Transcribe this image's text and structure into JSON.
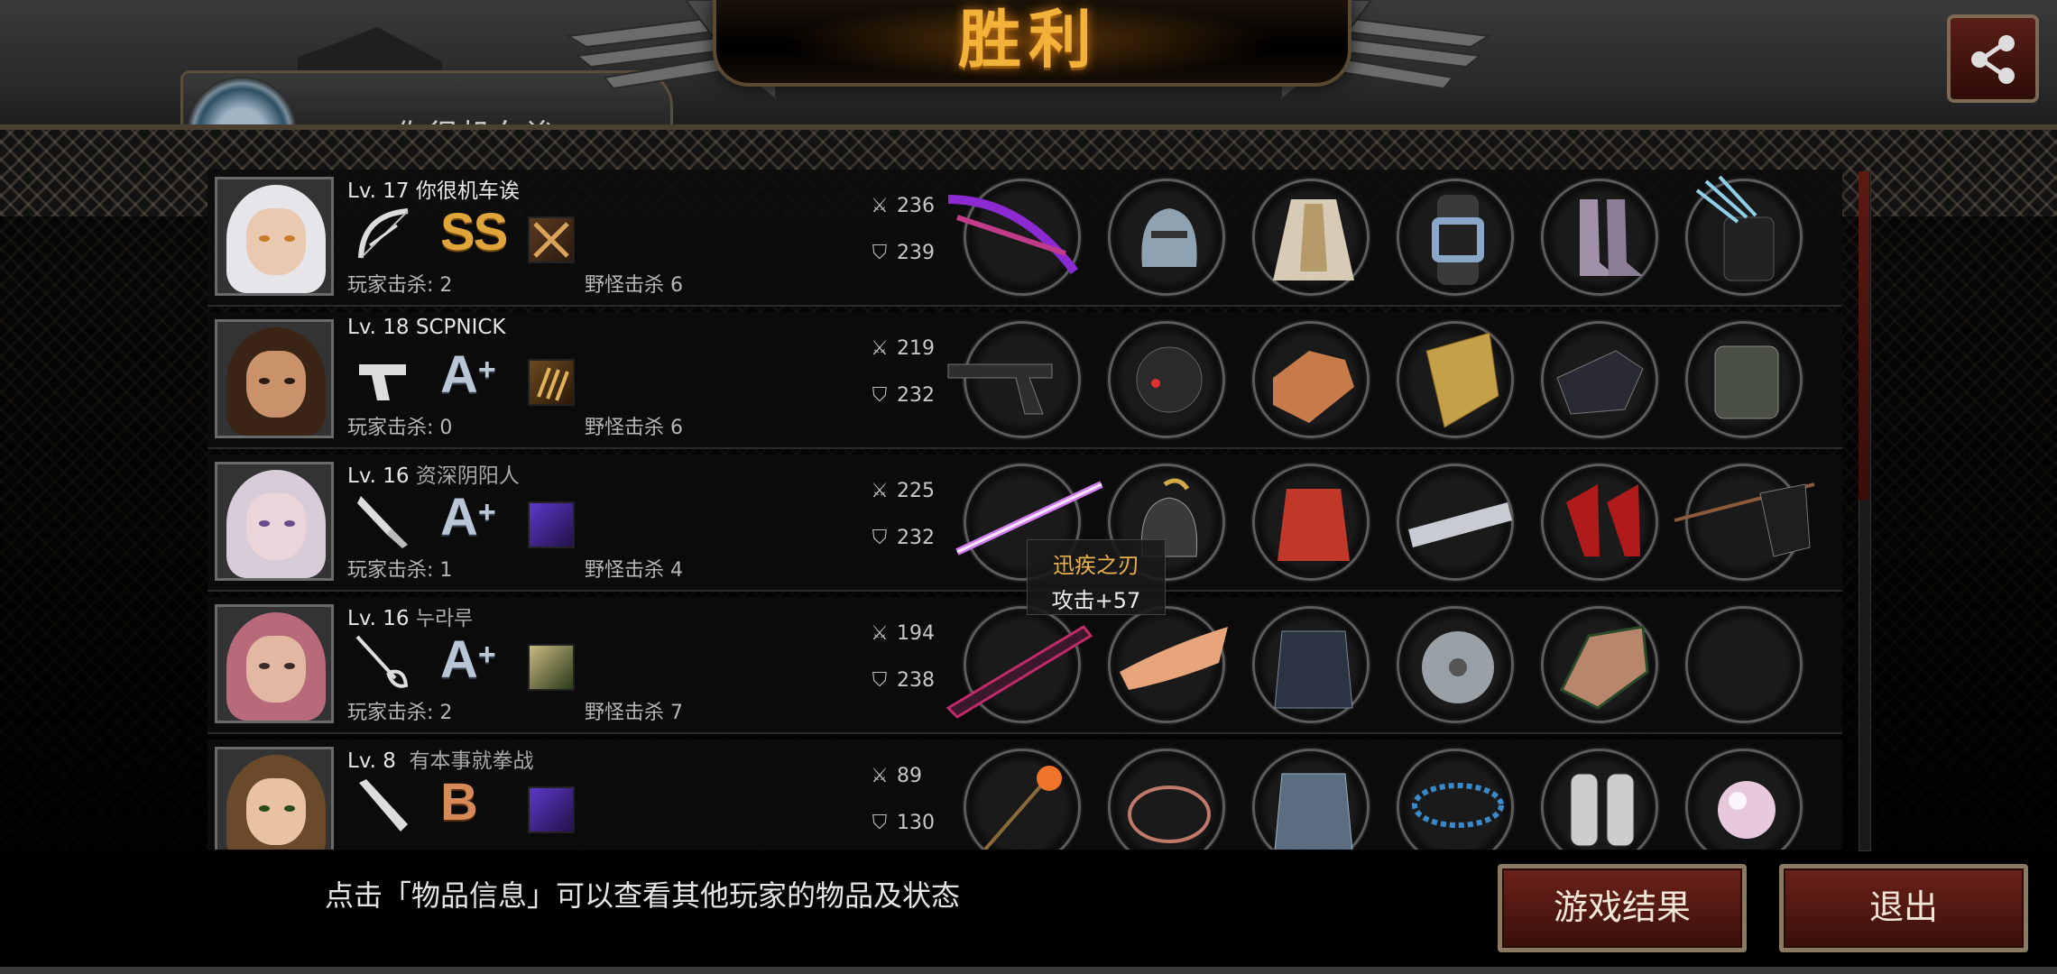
{
  "header": {
    "title": "胜利",
    "player_tab_text": "你很机车诶"
  },
  "tooltip": {
    "name": "迅疾之刃",
    "stat": "攻击+57"
  },
  "players": [
    {
      "level": "Lv. 17",
      "name": "你很机车诶",
      "weapon": "bow-icon",
      "grade": "SS",
      "skill": "crossed-blades-skill-icon",
      "player_kills_label": "玩家击杀: 2",
      "monster_kills_label": "野怪击杀 6",
      "attack": "236",
      "defense": "239",
      "items": [
        "purple-bow-icon",
        "helmet-icon",
        "cloak-icon",
        "wristwatch-icon",
        "boots-icon",
        "quiver-icon"
      ]
    },
    {
      "level": "Lv. 18",
      "name": "SCPNICK",
      "weapon": "pistol-icon",
      "grade": "A+",
      "skill": "claw-skill-icon",
      "player_kills_label": "玩家击杀: 0",
      "monster_kills_label": "野怪击杀 6",
      "attack": "219",
      "defense": "232",
      "items": [
        "revolver-icon",
        "mask-helmet-icon",
        "chain-armor-icon",
        "shield-icon",
        "gauntlet-icon",
        "vest-icon"
      ]
    },
    {
      "level": "Lv. 16",
      "name": "资深阴阳人",
      "weapon": "knife-icon",
      "grade": "A+",
      "skill": "purple-crystal-skill-icon",
      "player_kills_label": "玩家击杀: 1",
      "monster_kills_label": "野怪击杀 4",
      "attack": "225",
      "defense": "232",
      "items": [
        "lightsaber-icon",
        "knight-helmet-icon",
        "red-jacket-icon",
        "spiked-bracer-icon",
        "red-heels-icon",
        "flag-icon"
      ]
    },
    {
      "level": "Lv. 16",
      "name": "누라루",
      "weapon": "rapier-icon",
      "grade": "A+",
      "skill": "character-skill-icon",
      "player_kills_label": "玩家击杀: 2",
      "monster_kills_label": "野怪击杀 7",
      "attack": "194",
      "defense": "238",
      "items": [
        "dark-sword-icon",
        "tiara-icon",
        "leather-armor-icon",
        "round-shield-icon",
        "armored-glove-icon",
        "empty-slot"
      ]
    },
    {
      "level": "Lv. 8",
      "name": "有本事就拳战",
      "weapon": "bat-icon",
      "grade": "B",
      "skill": "purple-crystal-skill-icon",
      "player_kills_label": "",
      "monster_kills_label": "",
      "attack": "89",
      "defense": "130",
      "items": [
        "fire-wand-icon",
        "circlet-icon",
        "chainmail-icon",
        "necklace-icon",
        "knee-guards-icon",
        "pearl-icon"
      ]
    }
  ],
  "footer": {
    "hint": "点击「物品信息」可以查看其他玩家的物品及状态",
    "results_button": "游戏结果",
    "exit_button": "退出"
  },
  "colors": {
    "title_gold": "#f2b23a",
    "button_red": "#6a2219",
    "tooltip_name": "#e8b24a"
  }
}
